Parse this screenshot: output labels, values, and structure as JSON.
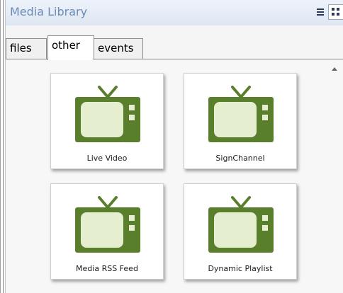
{
  "header": {
    "title": "Media Library",
    "view_list_icon": "list-view-icon",
    "view_grid_icon": "grid-view-icon"
  },
  "tabs": [
    {
      "label": "files",
      "active": false
    },
    {
      "label": "other",
      "active": true
    },
    {
      "label": "events",
      "active": false
    }
  ],
  "media_items": [
    {
      "label": "Live Video",
      "icon": "tv-icon"
    },
    {
      "label": "SignChannel",
      "icon": "tv-icon"
    },
    {
      "label": "Media RSS Feed",
      "icon": "tv-icon"
    },
    {
      "label": "Dynamic Playlist",
      "icon": "tv-icon"
    }
  ],
  "colors": {
    "title": "#6b8cb8",
    "tv_body": "#5a7f2c",
    "tv_screen": "#e6eed0"
  }
}
